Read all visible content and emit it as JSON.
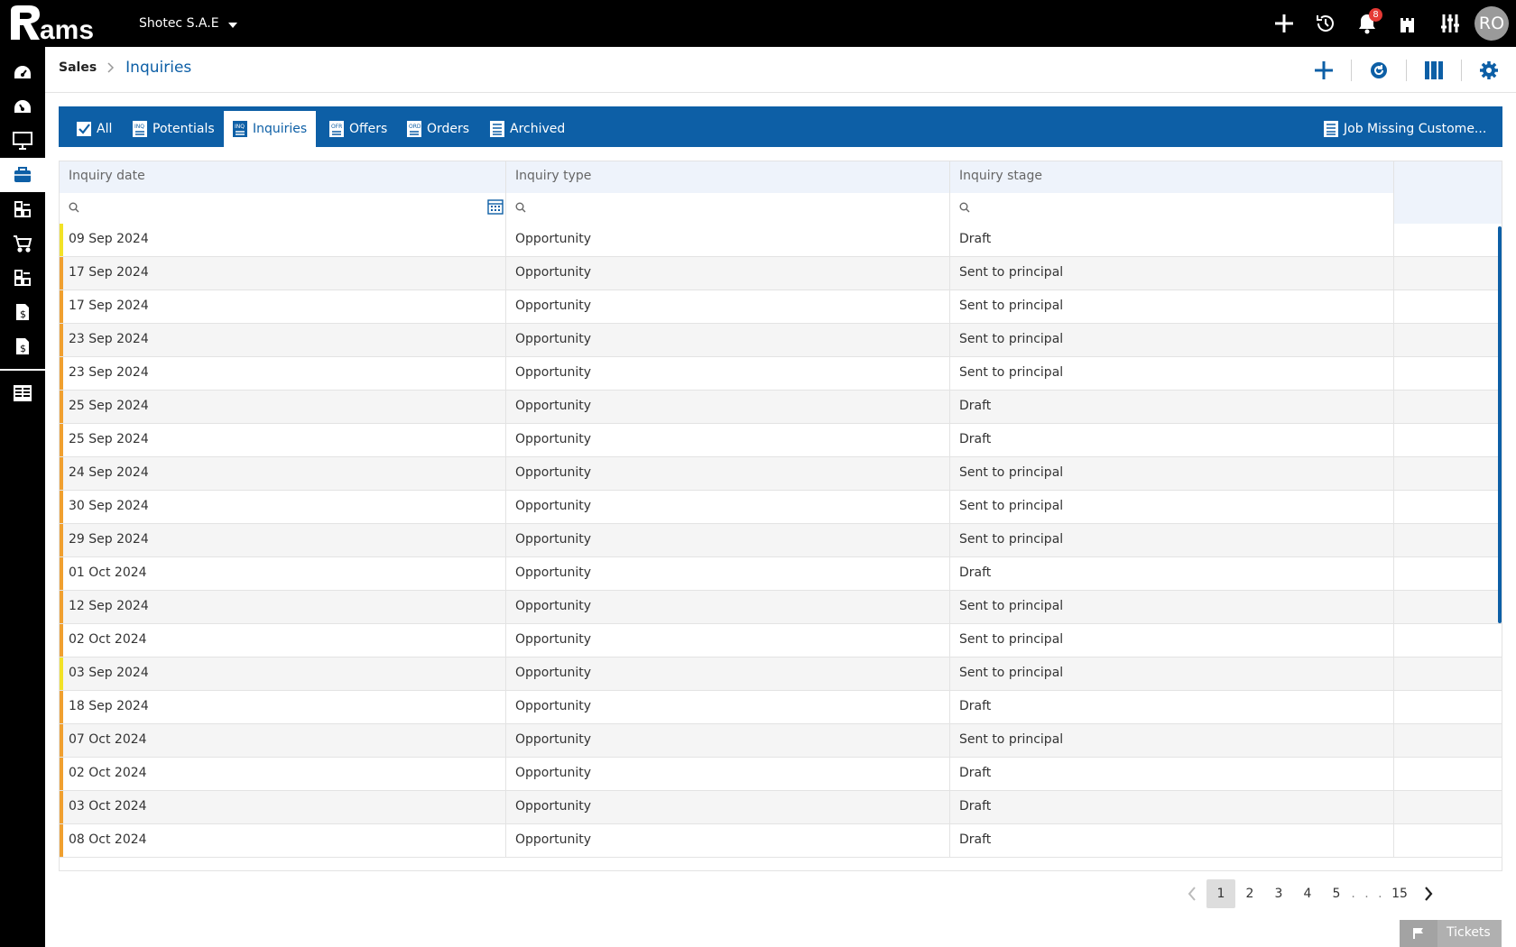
{
  "topbar": {
    "logo_text": "Rams",
    "company": "Shotec S.A.E",
    "notifications_count": "8",
    "avatar_initials": "RO"
  },
  "sidebar": {
    "items": [
      {
        "icon": "dashboard-icon"
      },
      {
        "icon": "dashboard-alt-icon"
      },
      {
        "icon": "monitor-icon"
      },
      {
        "icon": "briefcase-icon",
        "active": true
      },
      {
        "icon": "modules-icon"
      },
      {
        "icon": "cart-icon"
      },
      {
        "icon": "modules-alt-icon"
      },
      {
        "icon": "invoice-icon"
      },
      {
        "icon": "invoice-alt-icon"
      },
      {
        "icon": "reports-icon"
      }
    ]
  },
  "breadcrumb": {
    "root": "Sales",
    "current": "Inquiries"
  },
  "tabs": [
    {
      "label": "All",
      "icon": "check-icon"
    },
    {
      "label": "Potentials",
      "icon": "inq-doc-icon"
    },
    {
      "label": "Inquiries",
      "icon": "inq-doc-icon",
      "active": true
    },
    {
      "label": "Offers",
      "icon": "ofr-doc-icon"
    },
    {
      "label": "Orders",
      "icon": "ord-doc-icon"
    },
    {
      "label": "Archived",
      "icon": "archive-doc-icon"
    }
  ],
  "right_tab": {
    "label": "Job Missing Custome...",
    "icon": "doc-icon"
  },
  "grid": {
    "columns": [
      "Inquiry date",
      "Inquiry type",
      "Inquiry stage"
    ],
    "rows": [
      {
        "date": "09 Sep 2024",
        "type": "Opportunity",
        "stage": "Draft",
        "flag": "yellow"
      },
      {
        "date": "17 Sep 2024",
        "type": "Opportunity",
        "stage": "Sent to principal",
        "flag": "orange"
      },
      {
        "date": "17 Sep 2024",
        "type": "Opportunity",
        "stage": "Sent to principal",
        "flag": "orange"
      },
      {
        "date": "23 Sep 2024",
        "type": "Opportunity",
        "stage": "Sent to principal",
        "flag": "orange"
      },
      {
        "date": "23 Sep 2024",
        "type": "Opportunity",
        "stage": "Sent to principal",
        "flag": "orange"
      },
      {
        "date": "25 Sep 2024",
        "type": "Opportunity",
        "stage": "Draft",
        "flag": "orange"
      },
      {
        "date": "25 Sep 2024",
        "type": "Opportunity",
        "stage": "Draft",
        "flag": "orange"
      },
      {
        "date": "24 Sep 2024",
        "type": "Opportunity",
        "stage": "Sent to principal",
        "flag": "orange"
      },
      {
        "date": "30 Sep 2024",
        "type": "Opportunity",
        "stage": "Sent to principal",
        "flag": "orange"
      },
      {
        "date": "29 Sep 2024",
        "type": "Opportunity",
        "stage": "Sent to principal",
        "flag": "orange"
      },
      {
        "date": "01 Oct 2024",
        "type": "Opportunity",
        "stage": "Draft",
        "flag": "orange"
      },
      {
        "date": "12 Sep 2024",
        "type": "Opportunity",
        "stage": "Sent to principal",
        "flag": "orange"
      },
      {
        "date": "02 Oct 2024",
        "type": "Opportunity",
        "stage": "Sent to principal",
        "flag": "orange"
      },
      {
        "date": "03 Sep 2024",
        "type": "Opportunity",
        "stage": "Sent to principal",
        "flag": "yellow"
      },
      {
        "date": "18 Sep 2024",
        "type": "Opportunity",
        "stage": "Draft",
        "flag": "orange"
      },
      {
        "date": "07 Oct 2024",
        "type": "Opportunity",
        "stage": "Sent to principal",
        "flag": "orange"
      },
      {
        "date": "02 Oct 2024",
        "type": "Opportunity",
        "stage": "Draft",
        "flag": "orange"
      },
      {
        "date": "03 Oct 2024",
        "type": "Opportunity",
        "stage": "Draft",
        "flag": "orange"
      },
      {
        "date": "08 Oct 2024",
        "type": "Opportunity",
        "stage": "Draft",
        "flag": "orange"
      }
    ]
  },
  "pagination": {
    "pages": [
      "1",
      "2",
      "3",
      "4",
      "5"
    ],
    "current": "1",
    "ellipsis": ". . .",
    "last": "15"
  },
  "tickets_label": "Tickets",
  "colors": {
    "primary": "#0d5fa6",
    "flag_yellow": "#f2e227",
    "flag_orange": "#f0a030",
    "topbar": "#000000"
  }
}
